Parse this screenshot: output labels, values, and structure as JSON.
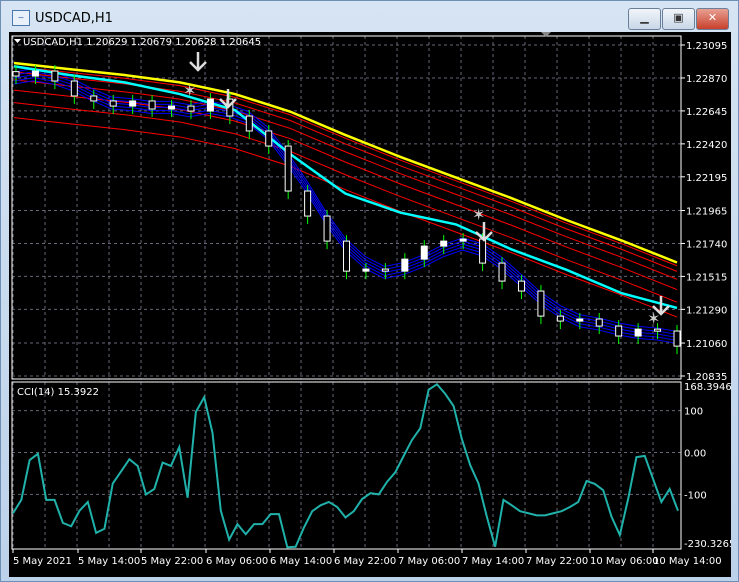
{
  "window": {
    "title": "USDCAD,H1",
    "icon": "chart-window-icon",
    "buttons": {
      "minimize": "minimize-icon",
      "maximize": "maximize-icon",
      "close": "close-icon"
    }
  },
  "chart_header": "USDCAD,H1  1.20629 1.20679 1.20628 1.20645",
  "indicator_label": "CCI(14) 15.3922",
  "colors": {
    "background": "#000000",
    "bull_candle": "#ffffff",
    "wick": "#00ff00",
    "ma_slow": "#ffff00",
    "ma_band": "#ff0000",
    "ma_mid": "#00ffff",
    "ma_fast": "#0000ff",
    "cci": "#20b2aa"
  },
  "chart_data": [
    {
      "type": "candlestick",
      "symbol": "USDCAD",
      "timeframe": "H1",
      "y_ticks": [
        "1.23095",
        "1.22870",
        "1.22645",
        "1.22420",
        "1.22195",
        "1.21965",
        "1.21740",
        "1.21515",
        "1.21290",
        "1.21060",
        "1.20835"
      ],
      "ylim": [
        1.20835,
        1.23095
      ],
      "x_ticks": [
        "5 May 2021",
        "5 May 14:00",
        "5 May 22:00",
        "6 May 06:00",
        "6 May 14:00",
        "6 May 22:00",
        "7 May 06:00",
        "7 May 14:00",
        "7 May 22:00",
        "10 May 06:00",
        "10 May 14:00"
      ],
      "closes": [
        1.22883,
        1.22917,
        1.22849,
        1.22747,
        1.22713,
        1.22678,
        1.22713,
        1.22658,
        1.22678,
        1.22644,
        1.22726,
        1.2261,
        1.22508,
        1.22405,
        1.22098,
        1.21927,
        1.21756,
        1.21551,
        1.21565,
        1.21551,
        1.21633,
        1.21722,
        1.21756,
        1.2177,
        1.21606,
        1.21483,
        1.21415,
        1.21244,
        1.2121,
        1.21224,
        1.21176,
        1.21108,
        1.21155,
        1.21142,
        1.21039
      ],
      "ma_slow": [
        1.22972,
        1.2293,
        1.2289,
        1.2284,
        1.2276,
        1.2264,
        1.2248,
        1.2233,
        1.2219,
        1.2205,
        1.219,
        1.2176,
        1.2161
      ],
      "ma_mid": [
        1.2295,
        1.2289,
        1.2284,
        1.2276,
        1.2265,
        1.2235,
        1.2208,
        1.2195,
        1.2187,
        1.217,
        1.2156,
        1.214,
        1.213
      ],
      "sell_arrows": 4,
      "star_marks": 3
    },
    {
      "type": "line",
      "name": "CCI(14)",
      "ylim": [
        -230.3265,
        168.3946
      ],
      "y_ticks": [
        "168.3946",
        "100",
        "0.00",
        "-100",
        "-230.3265"
      ],
      "values": [
        -145,
        -113,
        -18,
        -3,
        -113,
        -113,
        -168,
        -176,
        -139,
        -118,
        -192,
        -182,
        -74,
        -45,
        -16,
        -32,
        -100,
        -87,
        -24,
        -32,
        13,
        -108,
        97,
        132,
        47,
        -139,
        -208,
        -171,
        -195,
        -171,
        -171,
        -147,
        -147,
        -226,
        -225,
        -179,
        -140,
        -126,
        -118,
        -130,
        -155,
        -140,
        -111,
        -97,
        -100,
        -70,
        -47,
        -8,
        30,
        58,
        150,
        163,
        140,
        111,
        32,
        -30,
        -74,
        -153,
        -225,
        -113,
        -126,
        -140,
        -145,
        -150,
        -150,
        -145,
        -140,
        -130,
        -118,
        -68,
        -75,
        -90,
        -153,
        -197,
        -111,
        -11,
        -8,
        -63,
        -118,
        -87,
        -139
      ]
    }
  ]
}
